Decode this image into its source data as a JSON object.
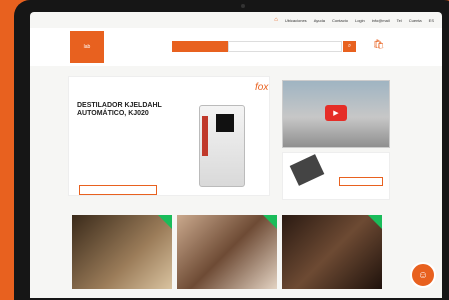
{
  "topbar": {
    "items": [
      "Ubicaciones",
      "Ayuda",
      "Contacto",
      "Login",
      "info@mail",
      "Tel",
      "Cuenta",
      "ES"
    ]
  },
  "header": {
    "logo_text": "lab",
    "category_button": "",
    "search_placeholder": ""
  },
  "hero": {
    "brand": "fox",
    "title": "DESTILADOR KJELDAHL AUTOMÁTICO, KJ020",
    "cta": ""
  },
  "icons": {
    "home": "home-icon",
    "search": "search-icon",
    "cart": "cart-icon",
    "play": "play-icon",
    "chat": "chat-avatar-icon"
  },
  "colors": {
    "accent": "#e8611f",
    "badge": "#1abc5a"
  }
}
